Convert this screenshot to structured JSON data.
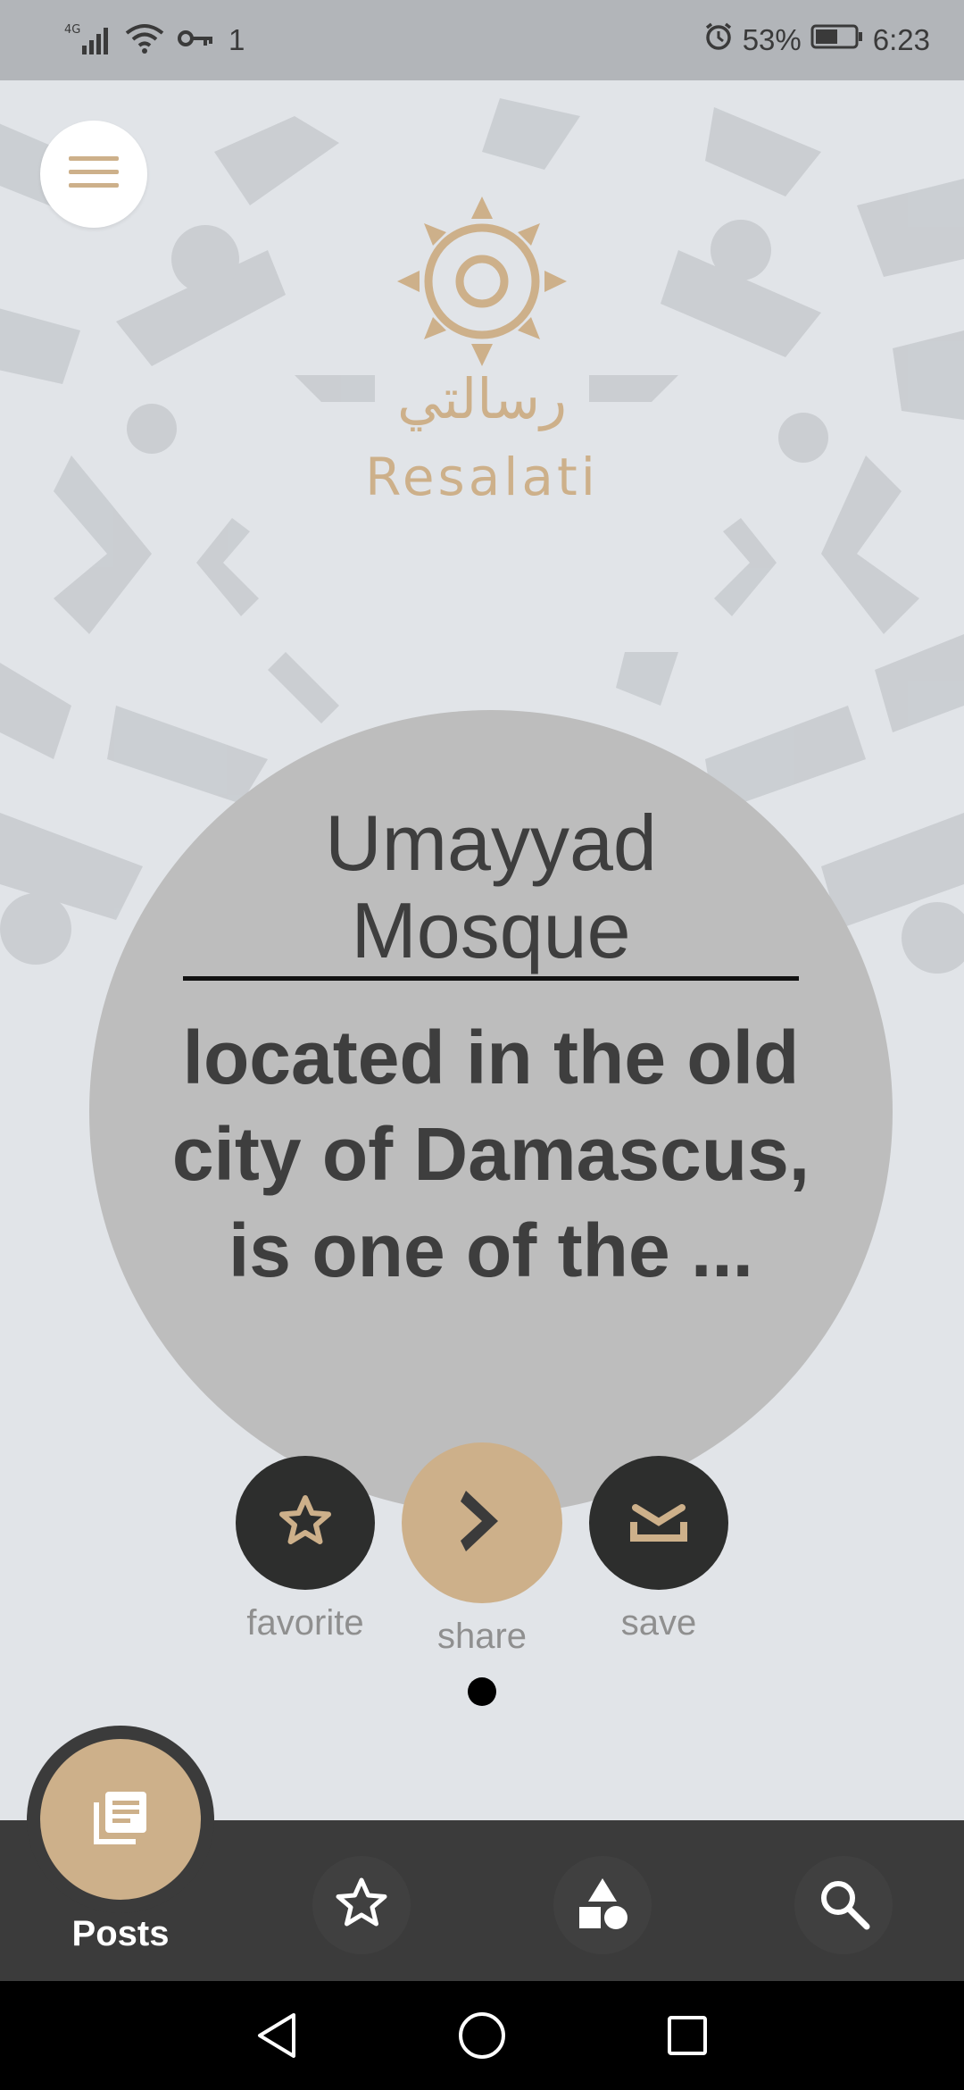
{
  "status_bar": {
    "network": "4G",
    "data_indicator": "1",
    "battery_percent": "53%",
    "time": "6:23"
  },
  "app": {
    "logo_arabic": "رسالتي",
    "logo_english": "Resalati",
    "brand_color": "#cdb08a"
  },
  "post": {
    "title": "Umayyad Mosque",
    "excerpt": "located in the old city of Damascus, is one of the ..."
  },
  "actions": {
    "favorite_label": "favorite",
    "share_label": "share",
    "save_label": "save"
  },
  "bottom_nav": {
    "active_label": "Posts",
    "items": [
      "posts-icon",
      "star-icon",
      "categories-icon",
      "search-icon"
    ]
  },
  "pagination": {
    "current": 1,
    "total": 1
  }
}
